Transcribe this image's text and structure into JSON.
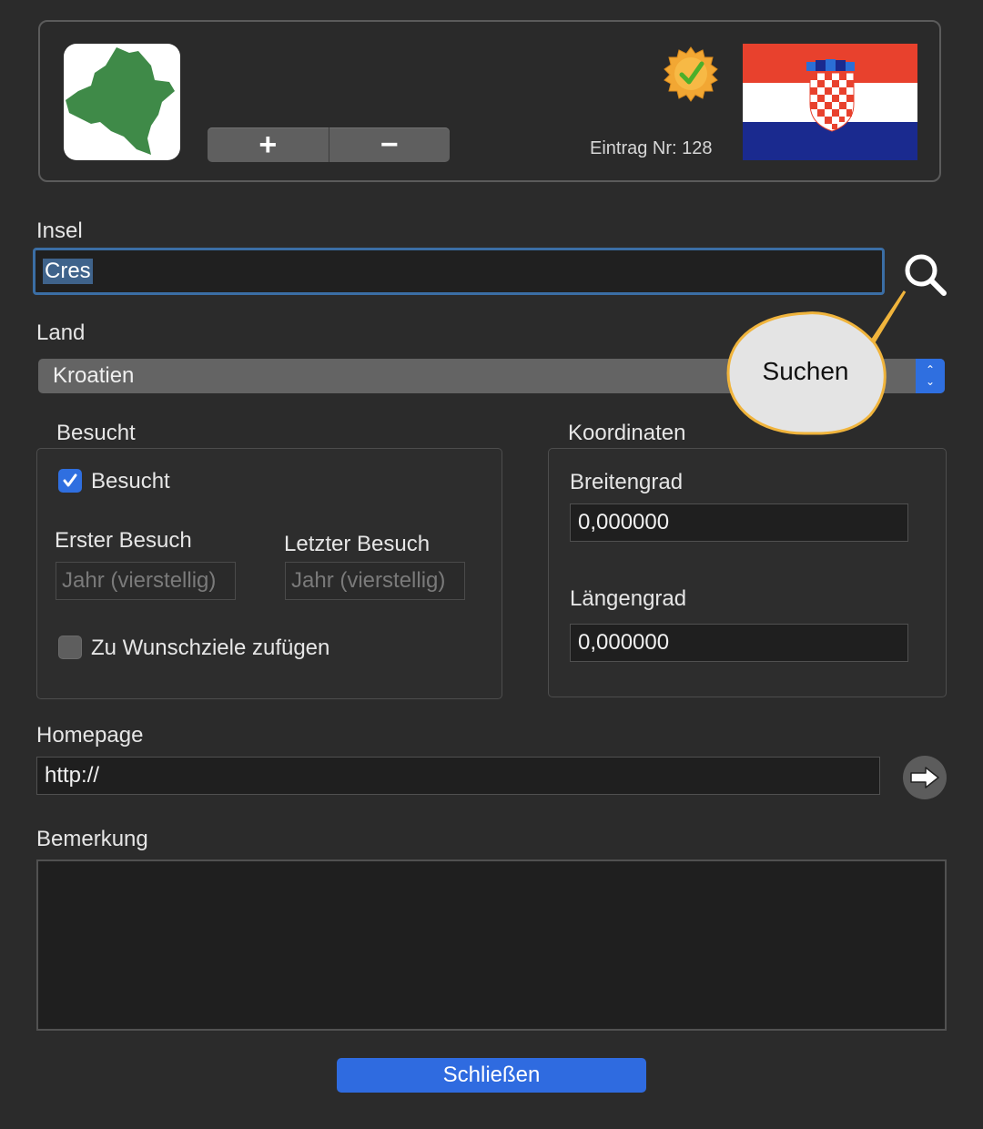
{
  "header": {
    "add_label": "+",
    "remove_label": "−",
    "entry_number": "Eintrag Nr: 128",
    "badge_icon": "verified-seal-icon",
    "flag": "croatia-flag"
  },
  "island": {
    "label": "Insel",
    "value": "Cres",
    "search_tooltip": "Suchen"
  },
  "country": {
    "label": "Land",
    "selected": "Kroatien"
  },
  "visited": {
    "group_label": "Besucht",
    "checkbox_label": "Besucht",
    "checked": true,
    "first_visit_label": "Erster Besuch",
    "last_visit_label": "Letzter Besuch",
    "year_placeholder": "Jahr (vierstellig)",
    "wishlist_label": "Zu Wunschziele zufügen",
    "wishlist_checked": false
  },
  "coordinates": {
    "group_label": "Koordinaten",
    "latitude_label": "Breitengrad",
    "latitude_value": "0,000000",
    "longitude_label": "Längengrad",
    "longitude_value": "0,000000"
  },
  "homepage": {
    "label": "Homepage",
    "value": "http://"
  },
  "remark": {
    "label": "Bemerkung"
  },
  "close_label": "Schließen",
  "colors": {
    "accent": "#2f6fe0",
    "background": "#2b2b2b"
  }
}
